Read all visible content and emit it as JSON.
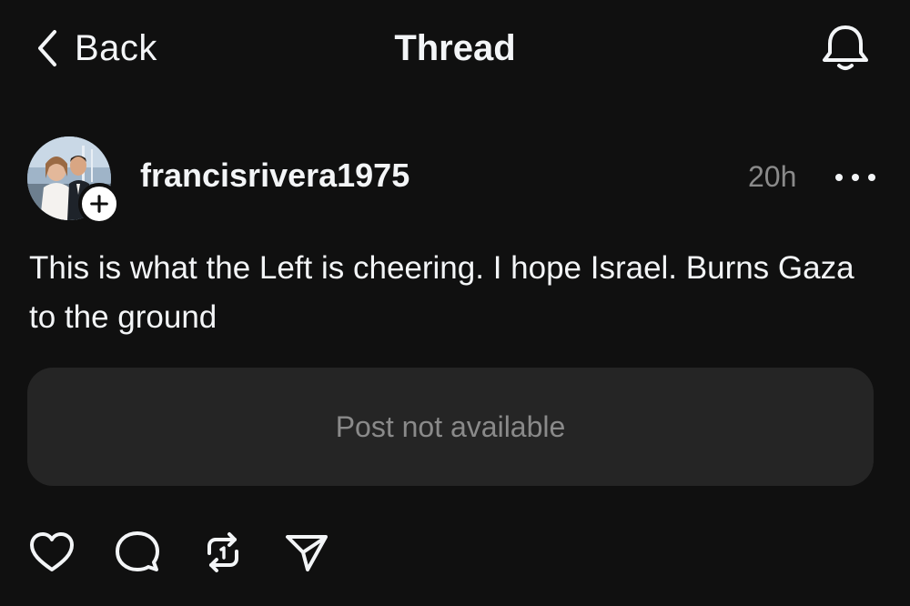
{
  "header": {
    "back_label": "Back",
    "title": "Thread",
    "back_icon": "chevron-left-icon",
    "bell_icon": "bell-icon"
  },
  "post": {
    "username": "francisrivera1975",
    "timestamp": "20h",
    "text": "This is what the Left is cheering. I hope Israel. Burns Gaza to the ground",
    "embedded_status": "Post not available"
  },
  "actions": [
    {
      "name": "like",
      "icon": "heart-icon"
    },
    {
      "name": "reply",
      "icon": "comment-bubble-icon"
    },
    {
      "name": "repost",
      "icon": "repost-icon"
    },
    {
      "name": "share",
      "icon": "send-icon"
    }
  ],
  "colors": {
    "background": "#101010",
    "text_primary": "#f3f5f7",
    "text_secondary": "#8a8a8a",
    "card_background": "#252525"
  }
}
